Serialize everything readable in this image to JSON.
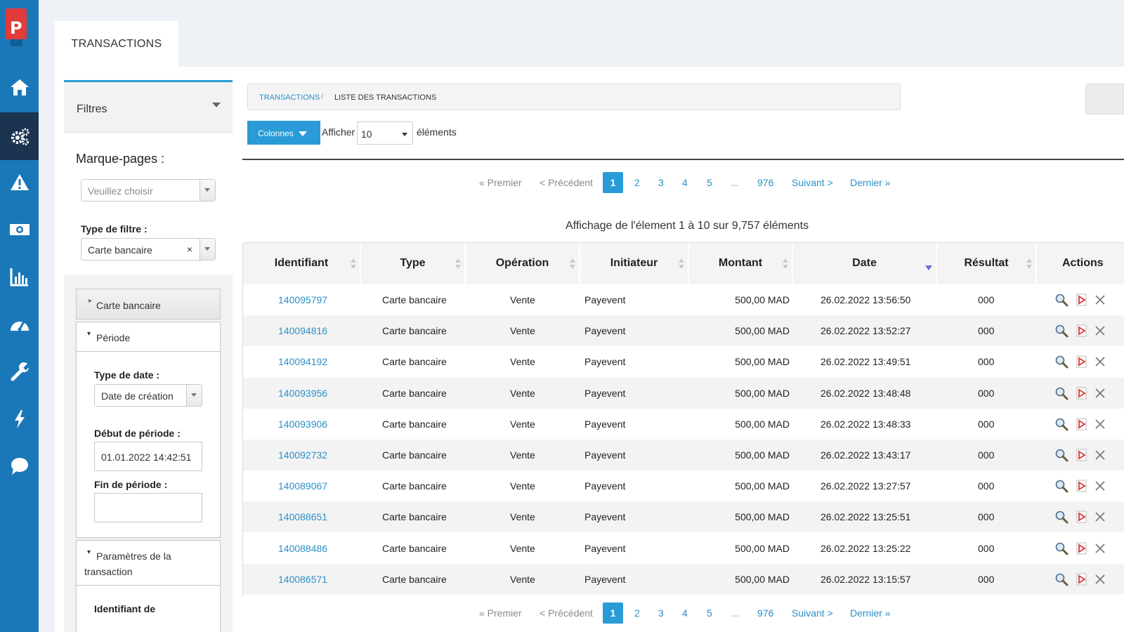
{
  "tab": {
    "title": "TRANSACTIONS"
  },
  "rail": {
    "items": [
      {
        "icon": "home-icon",
        "active": false
      },
      {
        "icon": "gears-icon",
        "active": true
      },
      {
        "icon": "warning-icon",
        "active": false
      },
      {
        "icon": "money-icon",
        "active": false
      },
      {
        "icon": "bar-chart-icon",
        "active": false
      },
      {
        "icon": "dashboard-icon",
        "active": false
      },
      {
        "icon": "wrench-icon",
        "active": false
      },
      {
        "icon": "bolt-icon",
        "active": false
      },
      {
        "icon": "chat-icon",
        "active": false
      }
    ]
  },
  "filters": {
    "title": "Filtres",
    "bookmarks_label": "Marque-pages :",
    "bookmarks_placeholder": "Veuillez choisir",
    "filter_type_label": "Type de filtre :",
    "filter_type_value": "Carte bancaire",
    "clear_symbol": "×",
    "section_card": "Carte bancaire",
    "section_period": "Période",
    "date_type_label": "Type de date :",
    "date_type_value": "Date de création",
    "start_label": "Début de période :",
    "start_value": "01.01.2022 14:42:51",
    "end_label": "Fin de période :",
    "end_value": "",
    "section_params_line1": "Paramètres de la",
    "section_params_line2": "transaction",
    "identifier_label": "Identifiant de"
  },
  "breadcrumb": {
    "root": "TRANSACTIONS",
    "separator": "/",
    "current": "LISTE DES TRANSACTIONS"
  },
  "toolbar": {
    "columns_label": "Colonnes",
    "show_label": "Afficher",
    "page_size": "10",
    "items_label": "éléments"
  },
  "pager": {
    "first": "« Premier",
    "prev": "< Précédent",
    "pages": [
      "1",
      "2",
      "3",
      "4",
      "5"
    ],
    "current": "1",
    "ellipsis": "...",
    "last_page": "976",
    "next": "Suivant >",
    "last": "Dernier »"
  },
  "summary": "Affichage de l'élement 1 à 10 sur 9,757 éléments",
  "table": {
    "columns": [
      "Identifiant",
      "Type",
      "Opération",
      "Initiateur",
      "Montant",
      "Date",
      "Résultat",
      "Actions"
    ],
    "sorted_column": "Date",
    "rows": [
      {
        "id": "140095797",
        "type": "Carte bancaire",
        "operation": "Vente",
        "initiator": "Payevent",
        "amount": "500,00 MAD",
        "date": "26.02.2022 13:56:50",
        "result": "000"
      },
      {
        "id": "140094816",
        "type": "Carte bancaire",
        "operation": "Vente",
        "initiator": "Payevent",
        "amount": "500,00 MAD",
        "date": "26.02.2022 13:52:27",
        "result": "000"
      },
      {
        "id": "140094192",
        "type": "Carte bancaire",
        "operation": "Vente",
        "initiator": "Payevent",
        "amount": "500,00 MAD",
        "date": "26.02.2022 13:49:51",
        "result": "000"
      },
      {
        "id": "140093956",
        "type": "Carte bancaire",
        "operation": "Vente",
        "initiator": "Payevent",
        "amount": "500,00 MAD",
        "date": "26.02.2022 13:48:48",
        "result": "000"
      },
      {
        "id": "140093906",
        "type": "Carte bancaire",
        "operation": "Vente",
        "initiator": "Payevent",
        "amount": "500,00 MAD",
        "date": "26.02.2022 13:48:33",
        "result": "000"
      },
      {
        "id": "140092732",
        "type": "Carte bancaire",
        "operation": "Vente",
        "initiator": "Payevent",
        "amount": "500,00 MAD",
        "date": "26.02.2022 13:43:17",
        "result": "000"
      },
      {
        "id": "140089067",
        "type": "Carte bancaire",
        "operation": "Vente",
        "initiator": "Payevent",
        "amount": "500,00 MAD",
        "date": "26.02.2022 13:27:57",
        "result": "000"
      },
      {
        "id": "140088651",
        "type": "Carte bancaire",
        "operation": "Vente",
        "initiator": "Payevent",
        "amount": "500,00 MAD",
        "date": "26.02.2022 13:25:51",
        "result": "000"
      },
      {
        "id": "140088486",
        "type": "Carte bancaire",
        "operation": "Vente",
        "initiator": "Payevent",
        "amount": "500,00 MAD",
        "date": "26.02.2022 13:25:22",
        "result": "000"
      },
      {
        "id": "140086571",
        "type": "Carte bancaire",
        "operation": "Vente",
        "initiator": "Payevent",
        "amount": "500,00 MAD",
        "date": "26.02.2022 13:15:57",
        "result": "000"
      }
    ],
    "row_actions": [
      "view-icon",
      "pdf-icon",
      "cancel-icon"
    ]
  },
  "colors": {
    "rail": "#1a78b8",
    "rail_active": "#1b3450",
    "accent": "#2a9bd6",
    "link": "#2a90c8",
    "logo": "#e23b3b"
  }
}
